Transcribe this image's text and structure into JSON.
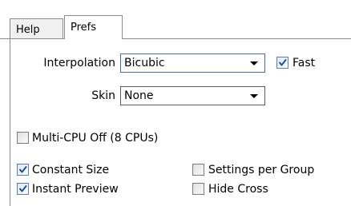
{
  "tabs": [
    {
      "label": "Help",
      "active": false
    },
    {
      "label": "Prefs",
      "active": true
    }
  ],
  "interpolation": {
    "label": "Interpolation",
    "value": "Bicubic"
  },
  "fast": {
    "label": "Fast",
    "checked": true
  },
  "skin": {
    "label": "Skin",
    "value": "None"
  },
  "multi_cpu": {
    "label": "Multi-CPU Off (8 CPUs)",
    "checked": false
  },
  "constant_size": {
    "label": "Constant Size",
    "checked": true
  },
  "settings_per_group": {
    "label": "Settings per Group",
    "checked": false
  },
  "instant_preview": {
    "label": "Instant Preview",
    "checked": true
  },
  "hide_cross": {
    "label": "Hide Cross",
    "checked": false
  },
  "colors": {
    "check": "#1f4fa0",
    "tab_border": "#8c8c8c",
    "dropdown_focus": "#3b6ea5"
  }
}
